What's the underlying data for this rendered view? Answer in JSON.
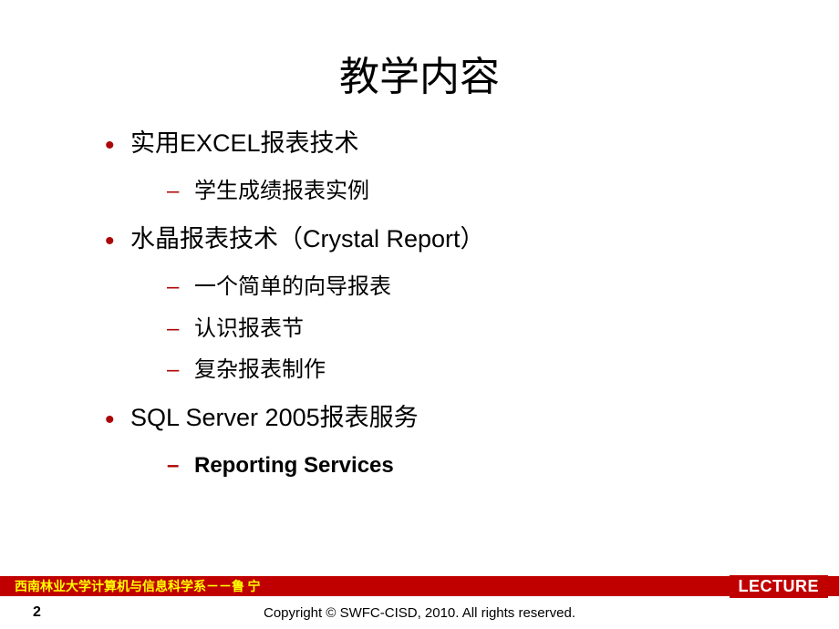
{
  "title": "教学内容",
  "items": [
    {
      "label": "实用EXCEL报表技术",
      "sub": [
        {
          "label": "学生成绩报表实例",
          "bold": false
        }
      ]
    },
    {
      "label": "水晶报表技术（Crystal Report）",
      "sub": [
        {
          "label": "一个简单的向导报表",
          "bold": false
        },
        {
          "label": "认识报表节",
          "bold": false
        },
        {
          "label": "复杂报表制作",
          "bold": false
        }
      ]
    },
    {
      "label": "SQL Server 2005报表服务",
      "sub": [
        {
          "label": "Reporting Services",
          "bold": true
        }
      ]
    }
  ],
  "footer": {
    "org_author": "西南林业大学计算机与信息科学系－－鲁  宁",
    "lecture": "LECTURE",
    "page": "2",
    "copyright": "Copyright  © SWFC-CISD,  2010.  All  rights  reserved."
  }
}
